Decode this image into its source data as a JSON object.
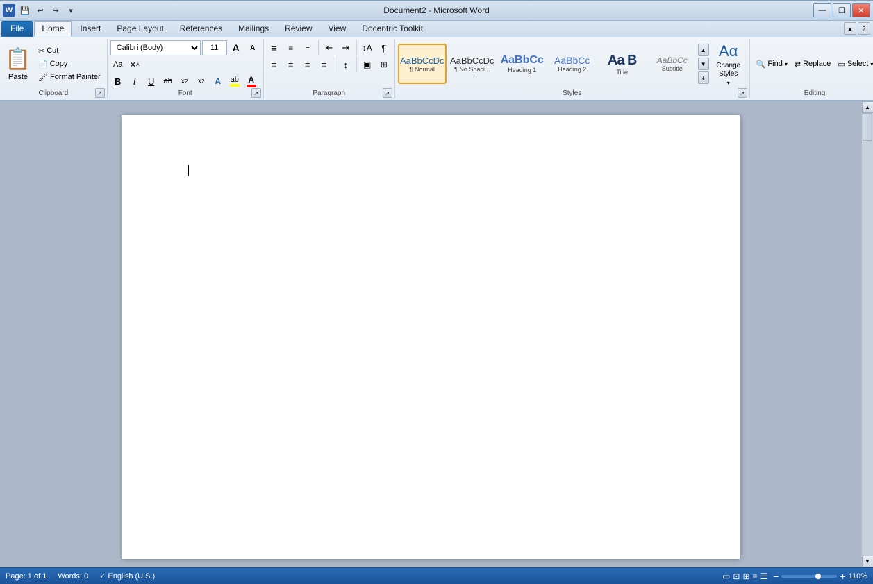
{
  "window": {
    "title": "Document2 - Microsoft Word",
    "min_label": "—",
    "restore_label": "❐",
    "close_label": "✕"
  },
  "quickaccess": {
    "save_label": "💾",
    "undo_label": "↩",
    "redo_label": "↪",
    "customize_label": "▾"
  },
  "tabs": [
    {
      "id": "file",
      "label": "File"
    },
    {
      "id": "home",
      "label": "Home",
      "active": true
    },
    {
      "id": "insert",
      "label": "Insert"
    },
    {
      "id": "pagelayout",
      "label": "Page Layout"
    },
    {
      "id": "references",
      "label": "References"
    },
    {
      "id": "mailings",
      "label": "Mailings"
    },
    {
      "id": "review",
      "label": "Review"
    },
    {
      "id": "view",
      "label": "View"
    },
    {
      "id": "docentric",
      "label": "Docentric Toolkit"
    }
  ],
  "clipboard": {
    "group_label": "Clipboard",
    "paste_label": "Paste",
    "cut_label": "Cut",
    "copy_label": "Copy",
    "format_painter_label": "Format Painter",
    "expand_label": "↗"
  },
  "font": {
    "group_label": "Font",
    "font_name": "Calibri (Body)",
    "font_size": "11",
    "grow_label": "A",
    "shrink_label": "A",
    "change_case_label": "Aa",
    "clear_label": "✕",
    "bold_label": "B",
    "italic_label": "I",
    "underline_label": "U",
    "strikethrough_label": "ab",
    "subscript_label": "x₂",
    "superscript_label": "x²",
    "text_effects_label": "A",
    "highlight_label": "ab",
    "font_color_label": "A",
    "expand_label": "↗"
  },
  "paragraph": {
    "group_label": "Paragraph",
    "bullets_label": "≡",
    "numbering_label": "≡#",
    "multilevel_label": "≡▾",
    "decrease_indent_label": "⇤",
    "increase_indent_label": "⇥",
    "sort_label": "↕",
    "show_marks_label": "¶",
    "align_left_label": "≡",
    "align_center_label": "≡",
    "align_right_label": "≡",
    "justify_label": "≡",
    "line_spacing_label": "↕",
    "shading_label": "▣",
    "borders_label": "⊞",
    "expand_label": "↗"
  },
  "styles": {
    "group_label": "Styles",
    "items": [
      {
        "id": "normal",
        "preview": "AaBbCcDc",
        "label": "¶ Normal",
        "active": true
      },
      {
        "id": "no-spacing",
        "preview": "AaBbCcDc",
        "label": "¶ No Spaci..."
      },
      {
        "id": "heading1",
        "preview": "AaBbCc",
        "label": "Heading 1"
      },
      {
        "id": "heading2",
        "preview": "AaBbCc",
        "label": "Heading 2"
      },
      {
        "id": "title",
        "preview": "Aa B",
        "label": "Title"
      },
      {
        "id": "subtitle",
        "preview": "AaBbCc",
        "label": "Subtitle"
      }
    ],
    "change_styles_label": "Change\nStyles",
    "scroll_up_label": "▲",
    "scroll_down_label": "▼",
    "expand_label": "↧",
    "expand_btn_label": "↗"
  },
  "editing": {
    "group_label": "Editing",
    "find_label": "Find",
    "find_arrow": "▾",
    "replace_label": "Replace",
    "select_label": "Select",
    "select_arrow": "▾"
  },
  "document": {
    "page_info": "Page: 1 of 1",
    "words_info": "Words: 0",
    "language": "English (U.S.)",
    "zoom_level": "110%"
  }
}
